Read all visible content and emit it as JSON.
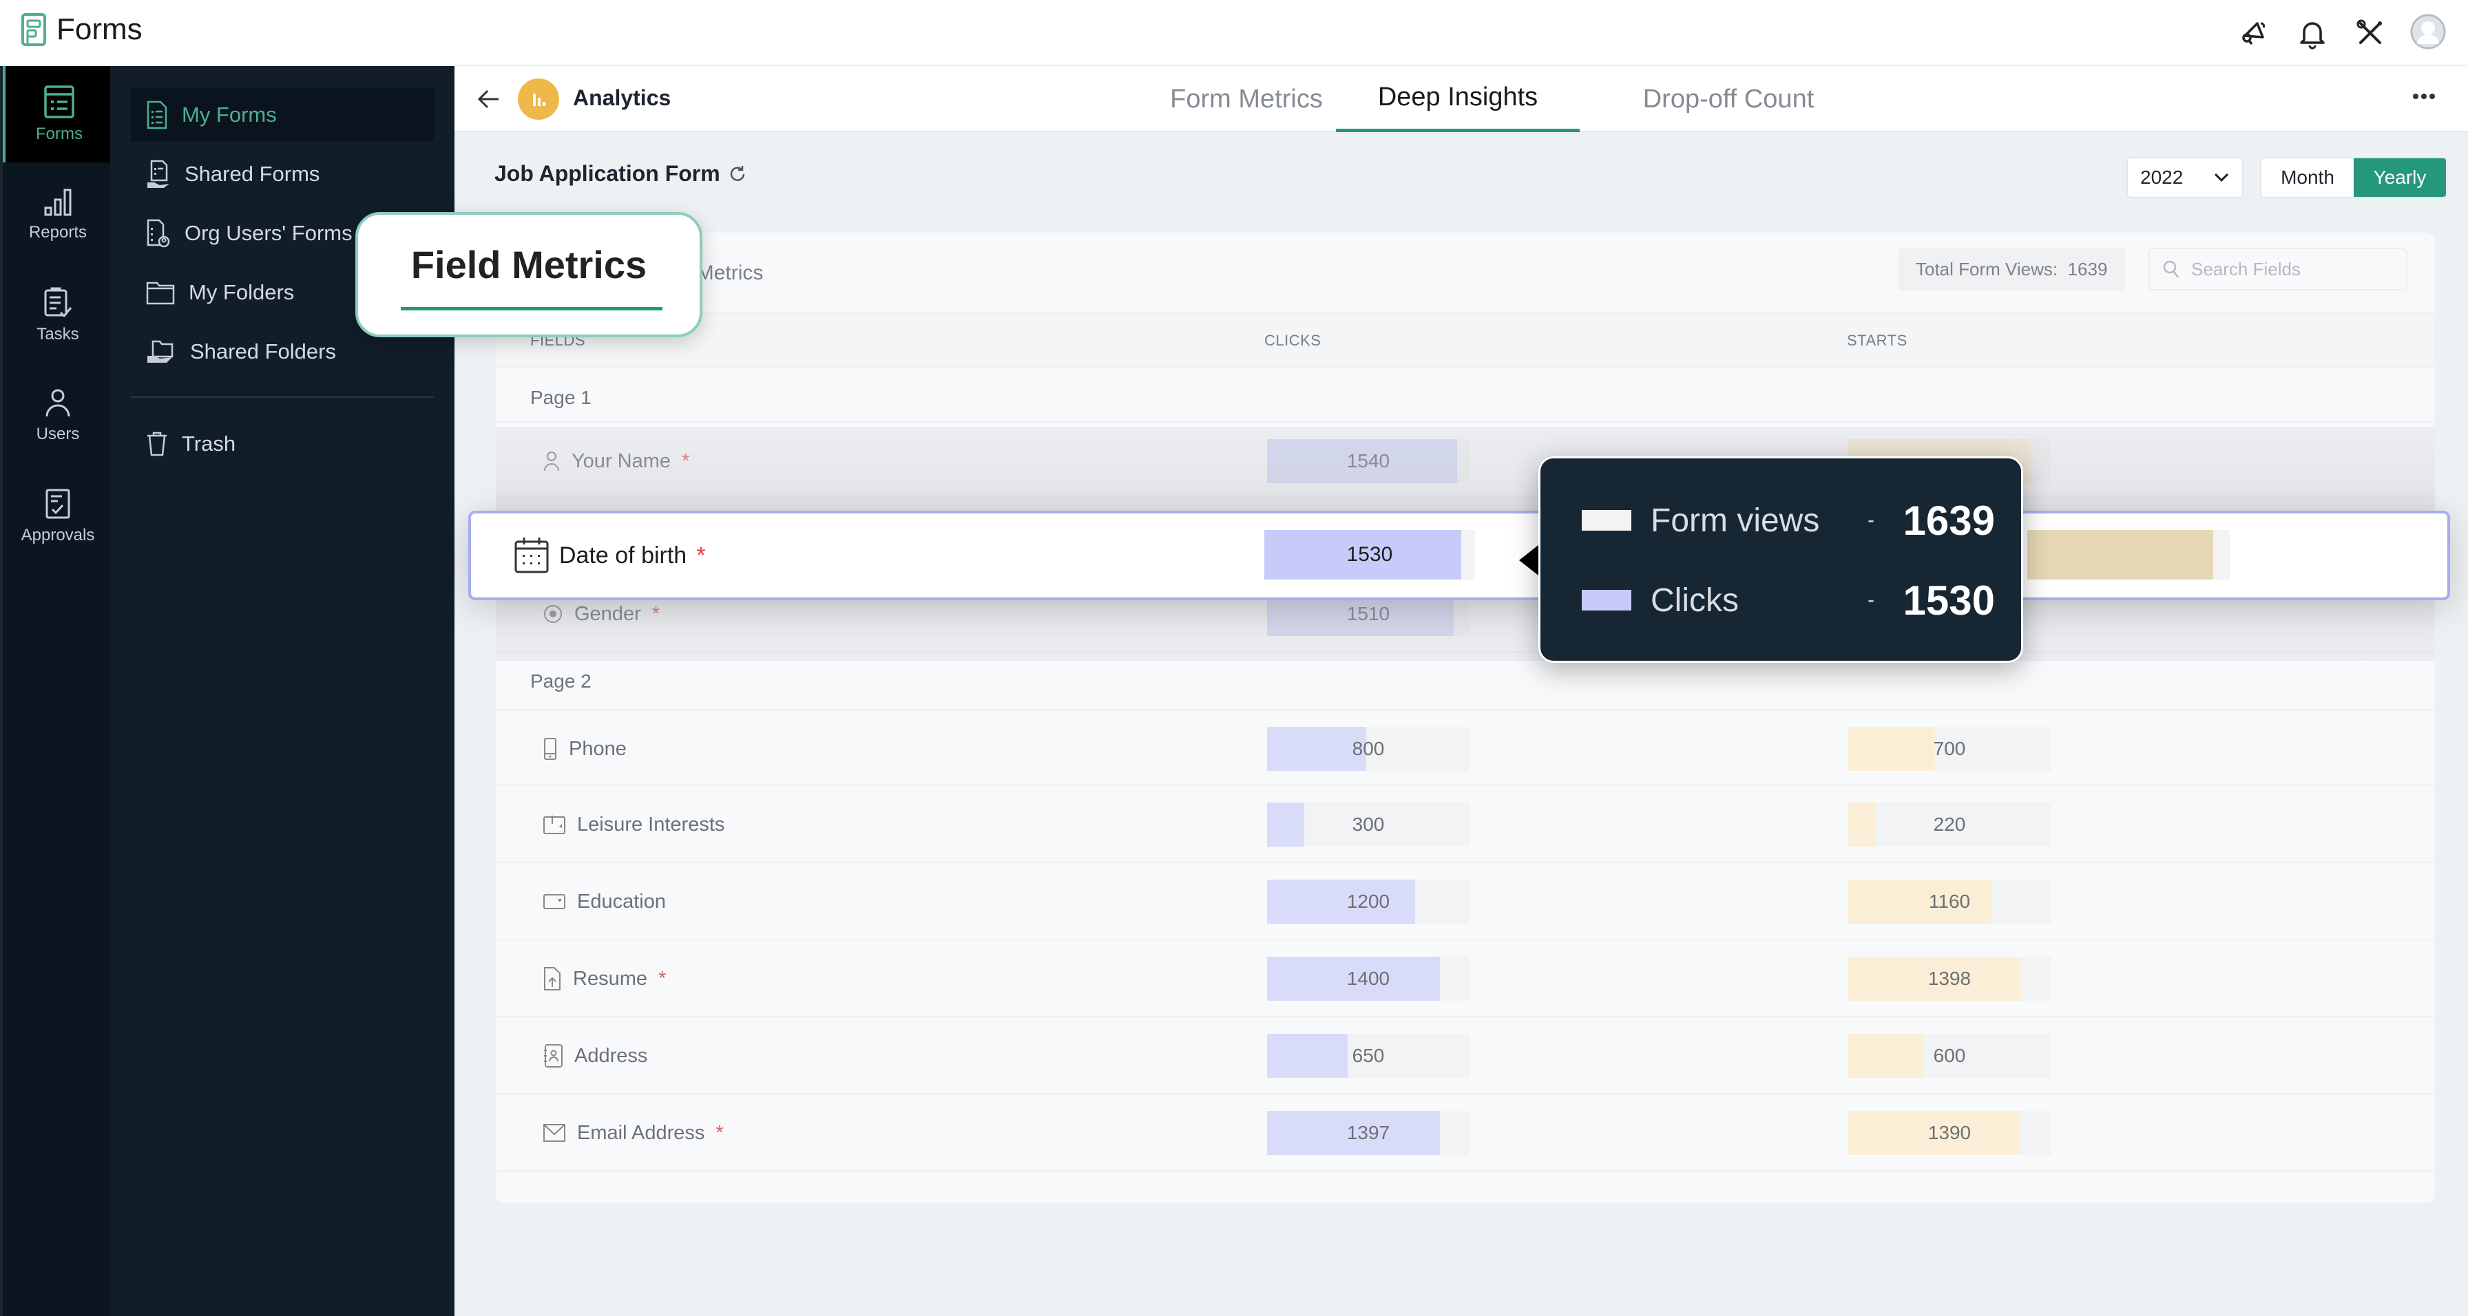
{
  "app": {
    "name": "Forms",
    "brand_color": "#4fae8f",
    "accent_color": "#24977c"
  },
  "topbar": {
    "icons": [
      "announcement-icon",
      "notification-bell-icon",
      "tools-icon",
      "user-avatar"
    ]
  },
  "rail": {
    "items": [
      {
        "label": "Forms",
        "icon": "forms-icon",
        "active": true
      },
      {
        "label": "Reports",
        "icon": "reports-icon",
        "active": false
      },
      {
        "label": "Tasks",
        "icon": "tasks-icon",
        "active": false
      },
      {
        "label": "Users",
        "icon": "users-icon",
        "active": false
      },
      {
        "label": "Approvals",
        "icon": "approvals-icon",
        "active": false
      }
    ]
  },
  "subnav": {
    "items": [
      {
        "label": "My Forms",
        "icon": "my-forms-icon",
        "active": true
      },
      {
        "label": "Shared Forms",
        "icon": "shared-forms-icon",
        "active": false
      },
      {
        "label": "Org Users' Forms",
        "icon": "org-users-forms-icon",
        "active": false
      },
      {
        "label": "My Folders",
        "icon": "folder-icon",
        "active": false
      },
      {
        "label": "Shared Folders",
        "icon": "shared-folder-icon",
        "active": false
      },
      {
        "label": "Trash",
        "icon": "trash-icon",
        "active": false
      }
    ]
  },
  "subheader": {
    "section": "Analytics",
    "tabs": [
      {
        "label": "Form Metrics",
        "active": false
      },
      {
        "label": "Deep Insights",
        "active": true
      },
      {
        "label": "Drop-off Count",
        "active": false
      }
    ]
  },
  "toolbar": {
    "form_title": "Job Application Form",
    "year": "2022",
    "period_options": [
      {
        "label": "Month",
        "active": false
      },
      {
        "label": "Yearly",
        "active": true
      }
    ]
  },
  "card": {
    "partial_tab_label": "ge Metrics",
    "total_views_label": "Total Form Views:",
    "total_views_value": "1639",
    "search_placeholder": "Search Fields",
    "columns": [
      "FIELDS",
      "CLICKS",
      "STARTS"
    ]
  },
  "callout": {
    "title": "Field Metrics"
  },
  "max_value": 1639,
  "pages": [
    {
      "label": "Page 1",
      "fields": [
        {
          "name": "Your Name",
          "required": true,
          "icon": "person-icon",
          "clicks": 1540,
          "starts": null
        },
        {
          "name": "Date of birth",
          "required": true,
          "icon": "calendar-icon",
          "clicks": 1530,
          "starts": null,
          "highlighted": true
        },
        {
          "name": "Gender",
          "required": true,
          "icon": "radio-icon",
          "clicks": 1510,
          "starts": null
        }
      ]
    },
    {
      "label": "Page 2",
      "fields": [
        {
          "name": "Phone",
          "required": false,
          "icon": "phone-icon",
          "clicks": 800,
          "starts": 700
        },
        {
          "name": "Leisure Interests",
          "required": false,
          "icon": "checkbox-field-icon",
          "clicks": 300,
          "starts": 220
        },
        {
          "name": "Education",
          "required": false,
          "icon": "dropdown-field-icon",
          "clicks": 1200,
          "starts": 1160
        },
        {
          "name": "Resume",
          "required": true,
          "icon": "file-upload-icon",
          "clicks": 1400,
          "starts": 1398
        },
        {
          "name": "Address",
          "required": false,
          "icon": "address-icon",
          "clicks": 650,
          "starts": 600
        },
        {
          "name": "Email Address",
          "required": true,
          "icon": "email-icon",
          "clicks": 1397,
          "starts": 1390
        }
      ]
    }
  ],
  "tooltip": {
    "rows": [
      {
        "label": "Form views",
        "value": "1639",
        "swatch": "#f3f3f3"
      },
      {
        "label": "Clicks",
        "value": "1530",
        "swatch": "#c7cbfa"
      }
    ]
  },
  "colors": {
    "clicks_bar": "#d8dcf8",
    "starts_bar": "#faefd6",
    "required_mark": "#e06060"
  }
}
